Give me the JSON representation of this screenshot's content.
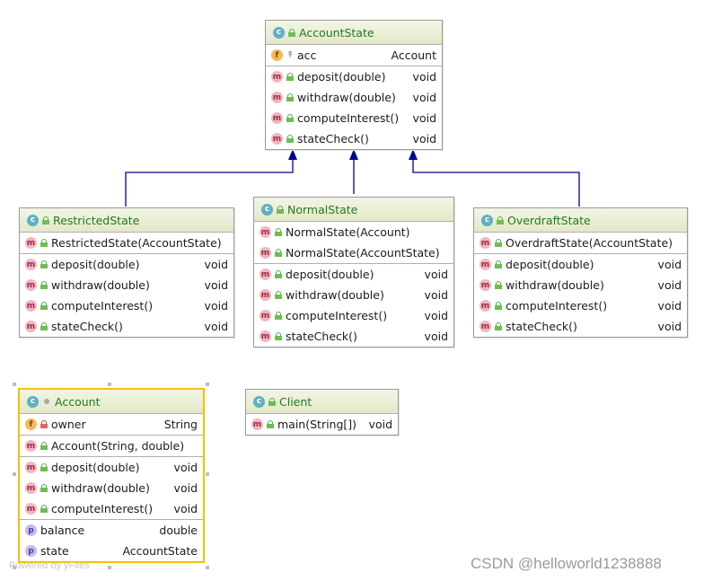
{
  "classes": {
    "account_state": {
      "name": "AccountState",
      "fields": [
        {
          "name": "acc",
          "type": "Account"
        }
      ],
      "methods": [
        {
          "name": "deposit(double)",
          "type": "void"
        },
        {
          "name": "withdraw(double)",
          "type": "void"
        },
        {
          "name": "computeInterest()",
          "type": "void"
        },
        {
          "name": "stateCheck()",
          "type": "void"
        }
      ]
    },
    "restricted_state": {
      "name": "RestrictedState",
      "constructors": [
        {
          "name": "RestrictedState(AccountState)",
          "type": ""
        }
      ],
      "methods": [
        {
          "name": "deposit(double)",
          "type": "void"
        },
        {
          "name": "withdraw(double)",
          "type": "void"
        },
        {
          "name": "computeInterest()",
          "type": "void"
        },
        {
          "name": "stateCheck()",
          "type": "void"
        }
      ]
    },
    "normal_state": {
      "name": "NormalState",
      "constructors": [
        {
          "name": "NormalState(Account)",
          "type": ""
        },
        {
          "name": "NormalState(AccountState)",
          "type": ""
        }
      ],
      "methods": [
        {
          "name": "deposit(double)",
          "type": "void"
        },
        {
          "name": "withdraw(double)",
          "type": "void"
        },
        {
          "name": "computeInterest()",
          "type": "void"
        },
        {
          "name": "stateCheck()",
          "type": "void"
        }
      ]
    },
    "overdraft_state": {
      "name": "OverdraftState",
      "constructors": [
        {
          "name": "OverdraftState(AccountState)",
          "type": ""
        }
      ],
      "methods": [
        {
          "name": "deposit(double)",
          "type": "void"
        },
        {
          "name": "withdraw(double)",
          "type": "void"
        },
        {
          "name": "computeInterest()",
          "type": "void"
        },
        {
          "name": "stateCheck()",
          "type": "void"
        }
      ]
    },
    "account": {
      "name": "Account",
      "fields": [
        {
          "name": "owner",
          "type": "String"
        }
      ],
      "constructors": [
        {
          "name": "Account(String, double)",
          "type": ""
        }
      ],
      "methods": [
        {
          "name": "deposit(double)",
          "type": "void"
        },
        {
          "name": "withdraw(double)",
          "type": "void"
        },
        {
          "name": "computeInterest()",
          "type": "void"
        }
      ],
      "properties": [
        {
          "name": "balance",
          "type": "double"
        },
        {
          "name": "state",
          "type": "AccountState"
        }
      ]
    },
    "client": {
      "name": "Client",
      "methods": [
        {
          "name": "main(String[])",
          "type": "void"
        }
      ]
    }
  },
  "badges": {
    "class": "c",
    "method": "m",
    "field": "f",
    "property": "p"
  },
  "watermarks": {
    "left": "Powered by yFiles",
    "right": "CSDN @helloworld1238888"
  },
  "colors": {
    "class_name": "#1f7b1f",
    "arrow": "#00008b",
    "selection": "#f2c200"
  }
}
